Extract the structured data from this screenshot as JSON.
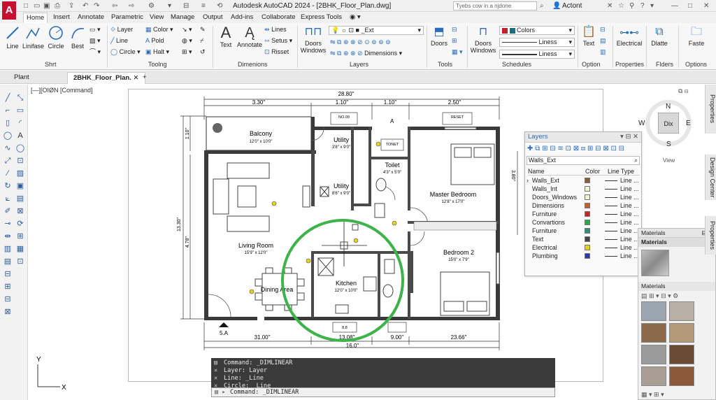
{
  "titlebar": {
    "app": "A",
    "title": "Autodesk AutoCAD 2024 - [2BHK_Floor_Plan.dwg]",
    "search_placeholder": "Tyebs cow in a njdone",
    "user": "Actont",
    "icons": [
      "save-icon",
      "undo-icon",
      "redo-icon",
      "print-icon",
      "share-icon",
      "help-icon"
    ]
  },
  "ribbon_tabs": [
    "Home",
    "Insert",
    "Annotate",
    "Parametric",
    "View",
    "Manage",
    "Output",
    "Add-ins",
    "Collaborate",
    "Express Tools"
  ],
  "ribbon": {
    "draw": {
      "line": "Line",
      "linifase": "Linifase",
      "circle": "Circle",
      "best": "Best",
      "panel": "Shrt"
    },
    "tooling": {
      "layer": "Layer",
      "line": "Line",
      "circle": "Circle",
      "color": "Color",
      "pold": "Pold",
      "halt": "Halt",
      "panel": "Toolng"
    },
    "dimensions": {
      "text": "Text",
      "annotate": "Annotate",
      "lines": "Lines",
      "setus": "Setus",
      "risset": "Risset",
      "panel": "Dimenions"
    },
    "layers": {
      "current": "_Ext",
      "doors_windows": "Doors\nWindows",
      "dimensions": "Dimensions",
      "panel": "Layers"
    },
    "tools": {
      "doors": "Doors",
      "panel": "Tools"
    },
    "schedules": {
      "doors_windows": "Doors\nWindows",
      "colors": "Colors",
      "liness1": "Liness",
      "liness2": "Liness",
      "panel": "Schedules"
    },
    "option": {
      "text": "Text",
      "panel": "Option"
    },
    "properties": {
      "electrical": "Electrical",
      "panel": "Properties"
    },
    "folders": {
      "dlatte": "Dlatte",
      "panel": "Flders"
    },
    "options": {
      "faste": "Faste",
      "panel": "Options"
    },
    "colors": {
      "swatch_red": "#c0202a",
      "swatch_teal": "#1f6b7a"
    }
  },
  "doc_tabs": [
    "Plant",
    "2BHK_Floor_Plan."
  ],
  "viewport_label": "[—][OIØN [Command]",
  "plan": {
    "dims_top": [
      "28.80\"",
      "3.30\"",
      "1.10\"",
      "1.10\"",
      "2.50\""
    ],
    "dims_bottom": [
      "31.00\"",
      "13.08\"",
      "9.00\"",
      "23.66\"",
      "16.0\""
    ],
    "dims_left": [
      "1.10\"",
      "13.30\"",
      "4.78\""
    ],
    "dims_right": [
      "3.80\""
    ],
    "rooms": [
      {
        "name": "Balcony",
        "size": "12'0\" x 10'0\""
      },
      {
        "name": "Utility",
        "size": "3'8\" x 9'0\""
      },
      {
        "name": "Utility",
        "size": "8'6\" x 9'0\""
      },
      {
        "name": "Toilet",
        "size": "4'3\" x 5'0\""
      },
      {
        "name": "Master Bedroom",
        "size": "12'8\" x 17'0\""
      },
      {
        "name": "Living Room",
        "size": "15'9\" x 12'0\""
      },
      {
        "name": "Dining Area",
        "size": ""
      },
      {
        "name": "Kitchen",
        "size": "12'0\" x 10'0\""
      },
      {
        "name": "Bedroom 2",
        "size": "15'0\" x 7'9\""
      }
    ],
    "tags": [
      "NO.09",
      "RESET",
      "TONET",
      "8.8",
      "A",
      "5.A"
    ],
    "entry_label": "5.A"
  },
  "compass": {
    "n": "N",
    "e": "E",
    "s": "S",
    "w": "W",
    "center": "Dix",
    "view": "View"
  },
  "layers_panel": {
    "title": "Layers",
    "filter": "Walls_Ext",
    "cols": [
      "Name",
      "Color",
      "Line Type"
    ],
    "rows": [
      {
        "name": "Walls_Ext",
        "color": "#8b5a3c",
        "lt": "Line ..."
      },
      {
        "name": "Walls_Int",
        "color": "#f2f2d0",
        "lt": "Line ..."
      },
      {
        "name": "Doors_Windows",
        "color": "#f2f2d0",
        "lt": "Line ..."
      },
      {
        "name": "Dimensions",
        "color": "#c06030",
        "lt": "Line ..."
      },
      {
        "name": "Furniture",
        "color": "#cc2222",
        "lt": "Line ..."
      },
      {
        "name": "Convartions",
        "color": "#2aa84a",
        "lt": "Line ..."
      },
      {
        "name": "Furniture",
        "color": "#3a8a7a",
        "lt": "Line ..."
      },
      {
        "name": "Text",
        "color": "#444444",
        "lt": "Line ..."
      },
      {
        "name": "Electrical",
        "color": "#e6d21c",
        "lt": "Line ..."
      },
      {
        "name": "Plumbing",
        "color": "#2a3aa8",
        "lt": "Line ..."
      }
    ]
  },
  "materials_panel": {
    "title": "Materials",
    "sub": "Materials",
    "browser": "Materials"
  },
  "side_tabs": [
    "Properties",
    "Design Center",
    "Properties"
  ],
  "command": {
    "history": [
      "Command: _DIMLINEAR",
      "Layer: Layer",
      "Line: _Line",
      "Circle: _Line"
    ],
    "input": "Command: _DIMLINEAR"
  },
  "ucs": {
    "x": "X",
    "y": "Y"
  }
}
